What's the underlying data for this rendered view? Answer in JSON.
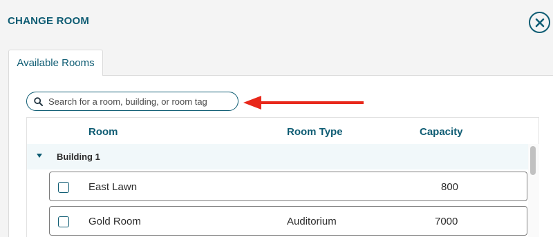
{
  "modal": {
    "title": "CHANGE ROOM",
    "close_icon": "close-circle-icon"
  },
  "tabs": [
    {
      "label": "Available Rooms",
      "active": true
    }
  ],
  "search": {
    "placeholder": "Search for a room, building, or room tag",
    "value": "",
    "icon": "search-icon"
  },
  "annotation": {
    "arrow_color": "#e8281b",
    "icon": "arrow-left-icon"
  },
  "table": {
    "columns": [
      "Room",
      "Room Type",
      "Capacity"
    ],
    "groups": [
      {
        "label": "Building 1",
        "expanded": true,
        "rows": [
          {
            "room": "East Lawn",
            "room_type": "",
            "capacity": "800",
            "checked": false
          },
          {
            "room": "Gold Room",
            "room_type": "Auditorium",
            "capacity": "7000",
            "checked": false
          }
        ]
      }
    ]
  },
  "colors": {
    "accent": "#0e5c73",
    "background": "#f4f4f4",
    "group_row_bg": "#f1f8fa",
    "arrow": "#e8281b"
  }
}
